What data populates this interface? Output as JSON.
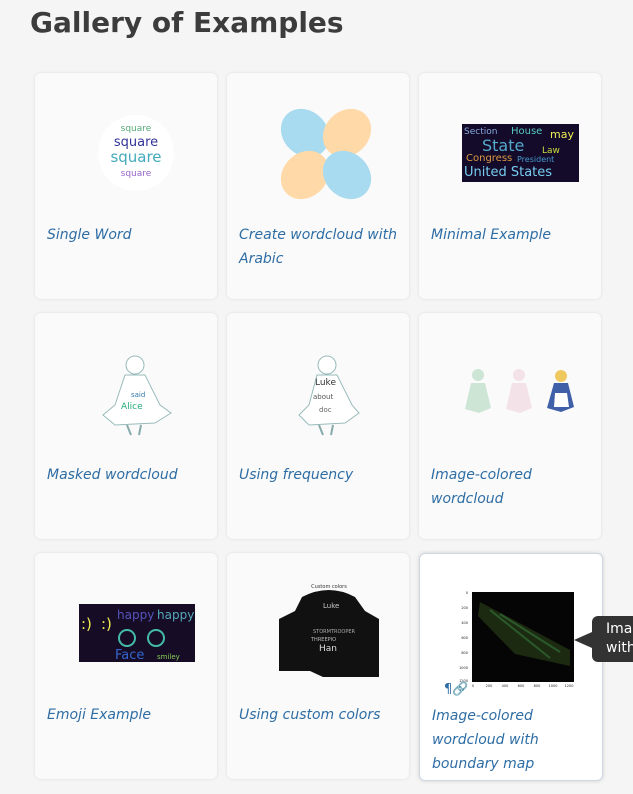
{
  "page": {
    "title": "Gallery of Examples"
  },
  "cards": [
    {
      "label": "Single Word"
    },
    {
      "label": "Create wordcloud with Arabic"
    },
    {
      "label": "Minimal Example"
    },
    {
      "label": "Masked wordcloud"
    },
    {
      "label": "Using frequency"
    },
    {
      "label": "Image-colored wordcloud"
    },
    {
      "label": "Emoji Example"
    },
    {
      "label": "Using custom colors"
    },
    {
      "label": "Image-colored wordcloud with boundary map"
    }
  ],
  "thumbs": {
    "single_word": {
      "words": [
        "square",
        "square",
        "square",
        "square"
      ]
    },
    "minimal": {
      "words": [
        "Section",
        "House",
        "may",
        "State",
        "Law",
        "Congress",
        "President",
        "United States"
      ]
    },
    "masked": {
      "words": [
        "Alice",
        "said"
      ]
    },
    "frequency": {
      "words": [
        "Luke",
        "about",
        "doc"
      ]
    },
    "emoji": {
      "words": [
        ":)",
        ":)",
        "happy",
        "happy",
        "Face",
        "smiley"
      ]
    },
    "custom_colors": {
      "title": "Custom colors",
      "words": [
        "Luke",
        "Han",
        "STORMTROOPER",
        "THREEPIO"
      ]
    },
    "boundary": {
      "y_ticks": [
        "0",
        "200",
        "400",
        "600",
        "800",
        "1000",
        "1200"
      ],
      "x_ticks": [
        "0",
        "200",
        "400",
        "600",
        "800",
        "1000",
        "1200"
      ]
    }
  },
  "anchor_icon": "¶🔗",
  "tooltip": {
    "text": "Image-colored wordcloud with boundary map",
    "visible_lines": [
      "Ima",
      "with"
    ]
  },
  "colors": {
    "link": "#2e6da4",
    "title": "#3c3c3c",
    "background": "#f5f5f5"
  }
}
